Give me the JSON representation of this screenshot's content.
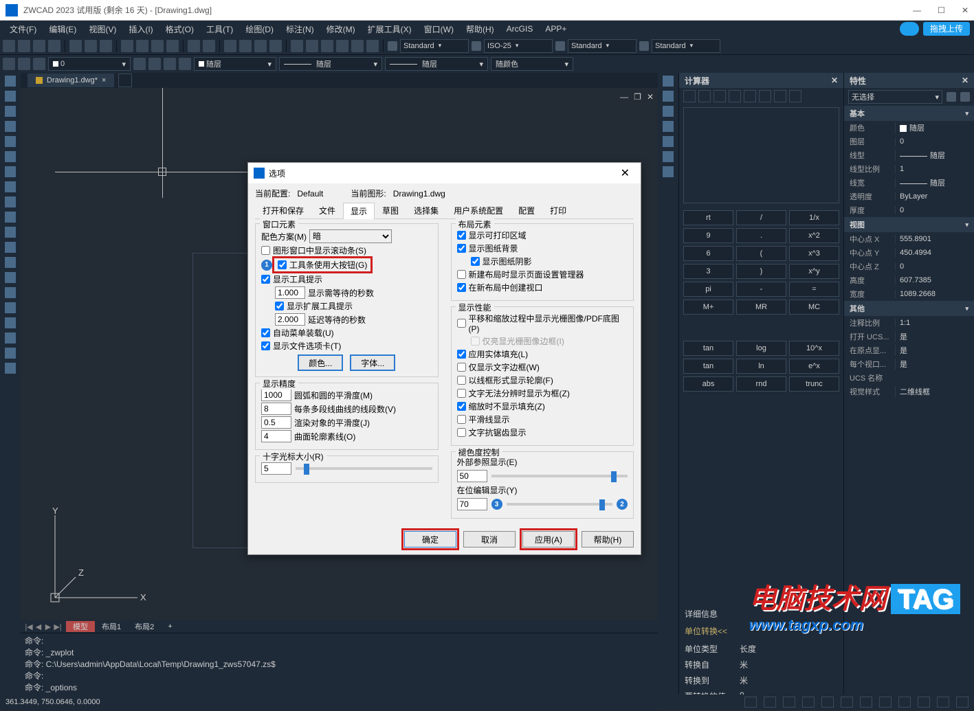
{
  "titlebar": {
    "title": "ZWCAD 2023 试用版 (剩余 16 天) - [Drawing1.dwg]"
  },
  "menubar": {
    "items": [
      "文件(F)",
      "编辑(E)",
      "视图(V)",
      "插入(I)",
      "格式(O)",
      "工具(T)",
      "绘图(D)",
      "标注(N)",
      "修改(M)",
      "扩展工具(X)",
      "窗口(W)",
      "帮助(H)",
      "ArcGIS",
      "APP+"
    ],
    "upload": "拖拽上传"
  },
  "toolbar_combos": {
    "textstyle": "Standard",
    "dimstyle": "ISO-25",
    "tablestyle": "Standard",
    "mleaderstyle": "Standard"
  },
  "layerbar": {
    "l1": "随层",
    "l2": "随层",
    "l3": "随层",
    "l4": "随颜色"
  },
  "doc_tab": "Drawing1.dwg*",
  "model_tabs": {
    "nav": [
      "|◀",
      "◀",
      "▶",
      "▶|"
    ],
    "active": "模型",
    "t1": "布局1",
    "t2": "布局2",
    "plus": "+"
  },
  "cmd": {
    "l1": "命令:",
    "l2": "命令: _zwplot",
    "l3": "命令: C:\\Users\\admin\\AppData\\Local\\Temp\\Drawing1_zws57047.zs$",
    "l4": "命令:",
    "l5": "命令: _options"
  },
  "statusbar": {
    "coords": "361.3449, 750.0646, 0.0000"
  },
  "calc": {
    "title": "计算器",
    "keys": [
      [
        "rt",
        "/",
        "1/x"
      ],
      [
        "9",
        ".",
        "x^2"
      ],
      [
        "6",
        "(",
        "x^3"
      ],
      [
        "3",
        ")",
        "x^y"
      ],
      [
        "pi",
        "-",
        "="
      ],
      [
        "M+",
        "MR",
        "MC"
      ],
      [
        "tan",
        "log",
        "10^x"
      ],
      [
        "tan",
        "ln",
        "e^x"
      ],
      [
        "abs",
        "rnd",
        "trunc"
      ]
    ],
    "detail_head": "详细信息",
    "unit_head": "单位转换<<",
    "rows": {
      "r1l": "单位类型",
      "r1v": "长度",
      "r2l": "转换自",
      "r2v": "米",
      "r3l": "转换到",
      "r3v": "米",
      "r4l": "要转换的值",
      "r4v": "0"
    }
  },
  "props": {
    "title": "特性",
    "selection": "无选择",
    "groups": {
      "basic": {
        "title": "基本",
        "rows": [
          {
            "l": "颜色",
            "v": "随层",
            "sw": true
          },
          {
            "l": "图层",
            "v": "0"
          },
          {
            "l": "线型",
            "v": "随层",
            "line": true
          },
          {
            "l": "线型比例",
            "v": "1"
          },
          {
            "l": "线宽",
            "v": "随层",
            "line": true
          },
          {
            "l": "透明度",
            "v": "ByLayer"
          },
          {
            "l": "厚度",
            "v": "0"
          }
        ]
      },
      "view": {
        "title": "视图",
        "rows": [
          {
            "l": "中心点 X",
            "v": "555.8901"
          },
          {
            "l": "中心点 Y",
            "v": "450.4994"
          },
          {
            "l": "中心点 Z",
            "v": "0"
          },
          {
            "l": "高度",
            "v": "607.7385"
          },
          {
            "l": "宽度",
            "v": "1089.2668"
          }
        ]
      },
      "other": {
        "title": "其他",
        "rows": [
          {
            "l": "注释比例",
            "v": "1:1"
          },
          {
            "l": "打开 UCS...",
            "v": "是"
          },
          {
            "l": "在原点显...",
            "v": "是"
          },
          {
            "l": "每个视口...",
            "v": "是"
          },
          {
            "l": "UCS 名称",
            "v": ""
          },
          {
            "l": "视觉样式",
            "v": "二维线框"
          }
        ]
      }
    }
  },
  "dialog": {
    "title": "选项",
    "profile_l": "当前配置:",
    "profile_v": "Default",
    "drawing_l": "当前图形:",
    "drawing_v": "Drawing1.dwg",
    "tabs": [
      "打开和保存",
      "文件",
      "显示",
      "草图",
      "选择集",
      "用户系统配置",
      "配置",
      "打印"
    ],
    "active_tab": 2,
    "window_elements": {
      "title": "窗口元素",
      "scheme_l": "配色方案(M)",
      "scheme_v": "暗",
      "scroll": "图形窗口中显示滚动条(S)",
      "bigbtn": "工具条使用大按钮(G)",
      "tooltip": "显示工具提示",
      "tooltip_sec": "显示需等待的秒数",
      "tooltip_sec_v": "1.000",
      "ext_tooltip": "显示扩展工具提示",
      "ext_delay": "延迟等待的秒数",
      "ext_delay_v": "2.000",
      "autoload": "自动菜单装载(U)",
      "filetabs": "显示文件选项卡(T)",
      "color_btn": "颜色...",
      "font_btn": "字体..."
    },
    "display_accuracy": {
      "title": "显示精度",
      "r1v": "1000",
      "r1l": "圆弧和圆的平滑度(M)",
      "r2v": "8",
      "r2l": "每条多段线曲线的线段数(V)",
      "r3v": "0.5",
      "r3l": "渲染对象的平滑度(J)",
      "r4v": "4",
      "r4l": "曲面轮廓素线(O)"
    },
    "crosshair": {
      "title": "十字光标大小(R)",
      "v": "5"
    },
    "layout_elements": {
      "title": "布局元素",
      "c1": "显示可打印区域",
      "c2": "显示图纸背景",
      "c3": "显示图纸阴影",
      "c4": "新建布局时显示页面设置管理器",
      "c5": "在新布局中创建视口"
    },
    "display_perf": {
      "title": "显示性能",
      "c1": "平移和缩放过程中显示光栅图像/PDF底图(P)",
      "c2": "仅亮显光栅图像边框(I)",
      "c3": "应用实体填充(L)",
      "c4": "仅显示文字边框(W)",
      "c5": "以线框形式显示轮廓(F)",
      "c6": "文字无法分辨时显示为框(Z)",
      "c7": "缩放时不显示填充(Z)",
      "c8": "平滑线显示",
      "c9": "文字抗锯齿显示"
    },
    "fade": {
      "title": "褪色度控制",
      "xref_l": "外部参照显示(E)",
      "xref_v": "50",
      "inplace_l": "在位编辑显示(Y)",
      "inplace_v": "70"
    },
    "buttons": {
      "ok": "确定",
      "cancel": "取消",
      "apply": "应用(A)",
      "help": "帮助(H)"
    }
  },
  "watermark": {
    "brand": "电脑技术网",
    "tag": "TAG",
    "url": "www.tagxp.com"
  },
  "ucs": {
    "x": "X",
    "y": "Y",
    "z": "Z"
  }
}
